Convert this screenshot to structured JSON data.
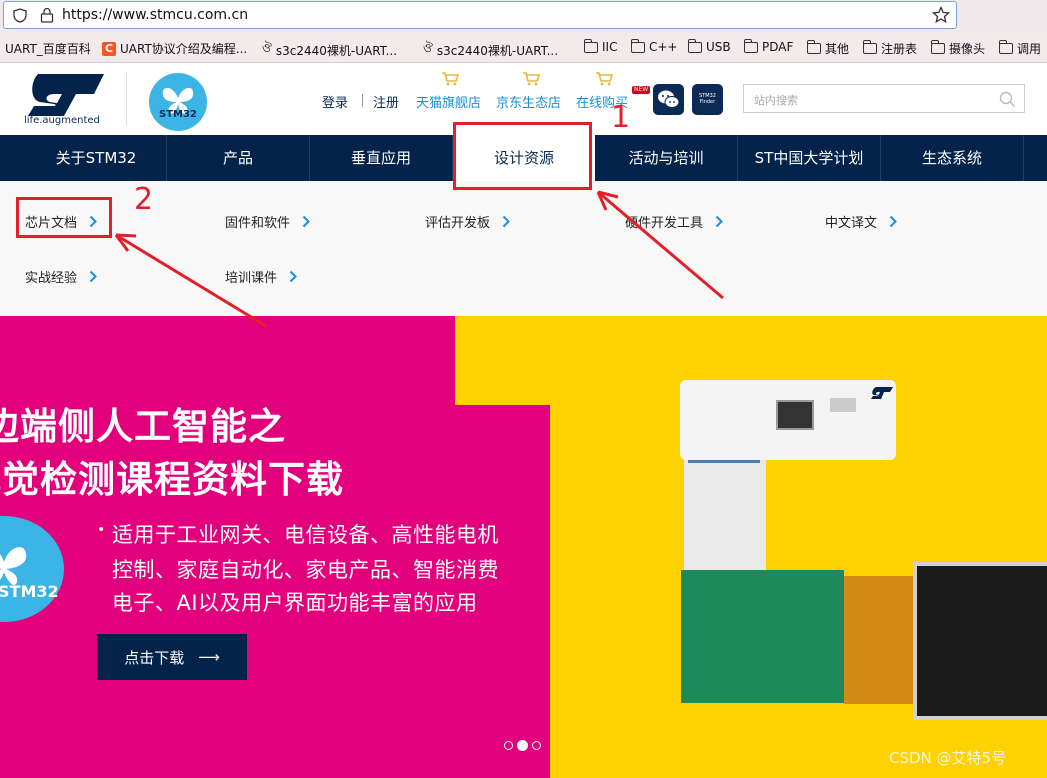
{
  "browser": {
    "url": "https://www.stmcu.com.cn",
    "bookmarks": [
      "UART_百度百科",
      "UART协议介绍及编程...",
      "s3c2440裸机-UART...",
      "s3c2440裸机-UART...",
      "IIC",
      "C++",
      "USB",
      "PDAF",
      "其他",
      "注册表",
      "摄像头",
      "调用"
    ]
  },
  "header": {
    "tagline": "life.augmented",
    "badge_text": "STM32",
    "login": "登录",
    "register": "注册",
    "tmall": "天猫旗舰店",
    "jd": "京东生态店",
    "online_buy": "在线购买",
    "new_badge": "NEW",
    "finder_text": "STM32 Finder",
    "search_placeholder": "站内搜索"
  },
  "nav": {
    "items": [
      "关于STM32",
      "产品",
      "垂直应用",
      "设计资源",
      "活动与培训",
      "ST中国大学计划",
      "生态系统"
    ],
    "active": "设计资源"
  },
  "dropdown": {
    "row1": [
      "芯片文档",
      "固件和软件",
      "评估开发板",
      "硬件开发工具",
      "中文译文"
    ],
    "row2": [
      "实战经验",
      "培训课件"
    ]
  },
  "banner": {
    "headline1": "边端侧人工智能之",
    "headline2": "视觉检测课程资料下载",
    "bullet": "•",
    "line1": "适用于工业网关、电信设备、高性能电机",
    "line2": "控制、家庭自动化、家电产品、智能消费",
    "line3": "电子、AI以及用户界面功能丰富的应用",
    "circle_text": "STM32",
    "cta": "点击下载",
    "cta_arrow": "⟶",
    "slides_total": 3,
    "slide_active": 2
  },
  "annotations": {
    "num1": "1",
    "num2": "2",
    "color": "#e3202a"
  },
  "watermark": "CSDN @艾特5号",
  "colors": {
    "navy": "#03234b",
    "magenta": "#e3007d",
    "yellow": "#ffd100",
    "st_blue": "#3cb4e5",
    "link_blue": "#1a8fd8"
  }
}
